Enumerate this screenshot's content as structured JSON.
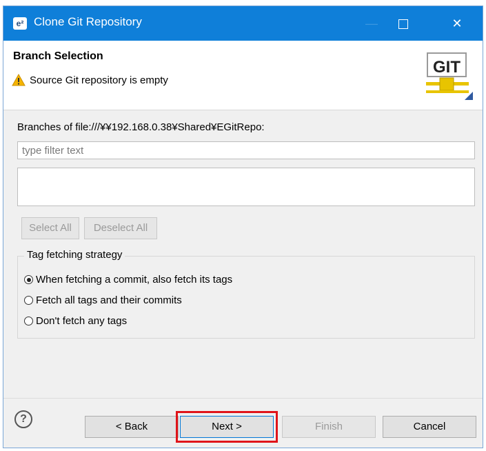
{
  "window": {
    "title": "Clone Git Repository",
    "app_icon_text": "e²"
  },
  "titlebar": {
    "minimize": "—",
    "close": "✕"
  },
  "header": {
    "title": "Branch Selection",
    "warning": "Source Git repository is empty",
    "logo_text": "GIT"
  },
  "branches": {
    "label": "Branches of file:///¥¥192.168.0.38¥Shared¥EGitRepo:",
    "filter_placeholder": "type filter text",
    "filter_value": ""
  },
  "buttons_select": {
    "select_all": "Select All",
    "deselect_all": "Deselect All"
  },
  "tag_strategy": {
    "legend": "Tag fetching strategy",
    "options": [
      {
        "label": "When fetching a commit, also fetch its tags",
        "checked": true
      },
      {
        "label": "Fetch all tags and their commits",
        "checked": false
      },
      {
        "label": "Don't fetch any tags",
        "checked": false
      }
    ]
  },
  "footer": {
    "help": "?",
    "back": "< Back",
    "next": "Next >",
    "finish": "Finish",
    "cancel": "Cancel"
  },
  "colors": {
    "titlebar": "#0f7fd9",
    "highlight": "#e0141a",
    "warning": "#f5b400"
  }
}
